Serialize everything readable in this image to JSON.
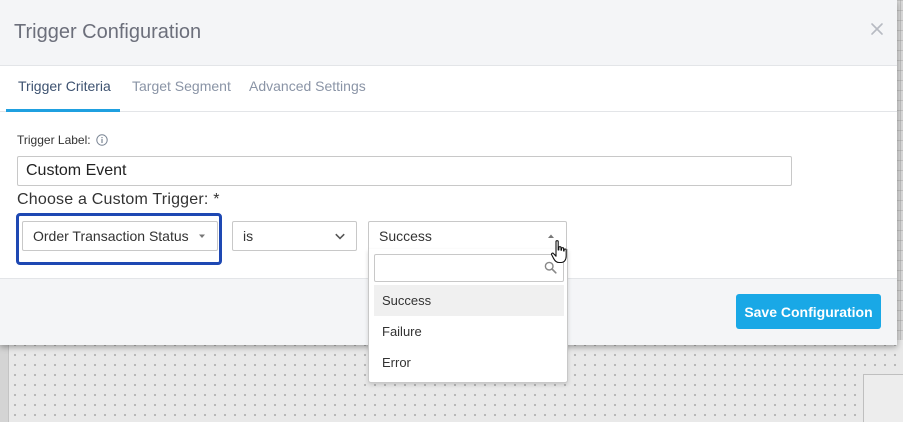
{
  "modal": {
    "title": "Trigger Configuration",
    "close_icon": "close-icon"
  },
  "tabs": [
    {
      "label": "Trigger Criteria",
      "active": true
    },
    {
      "label": "Target Segment",
      "active": false
    },
    {
      "label": "Advanced Settings",
      "active": false
    }
  ],
  "form": {
    "trigger_label": "Trigger Label:",
    "trigger_label_value": "Custom Event",
    "choose_heading": "Choose a Custom Trigger: *",
    "trigger_select": "Order Transaction Status",
    "operator_select": "is",
    "value_select": "Success"
  },
  "dropdown": {
    "search_placeholder": "",
    "options": [
      "Success",
      "Failure",
      "Error"
    ],
    "hovered": "Success"
  },
  "footer": {
    "save_label": "Save Configuration"
  },
  "colors": {
    "accent": "#19a8e6",
    "tab_underline": "#1fa0e0",
    "highlight_border": "#1e48b3"
  }
}
